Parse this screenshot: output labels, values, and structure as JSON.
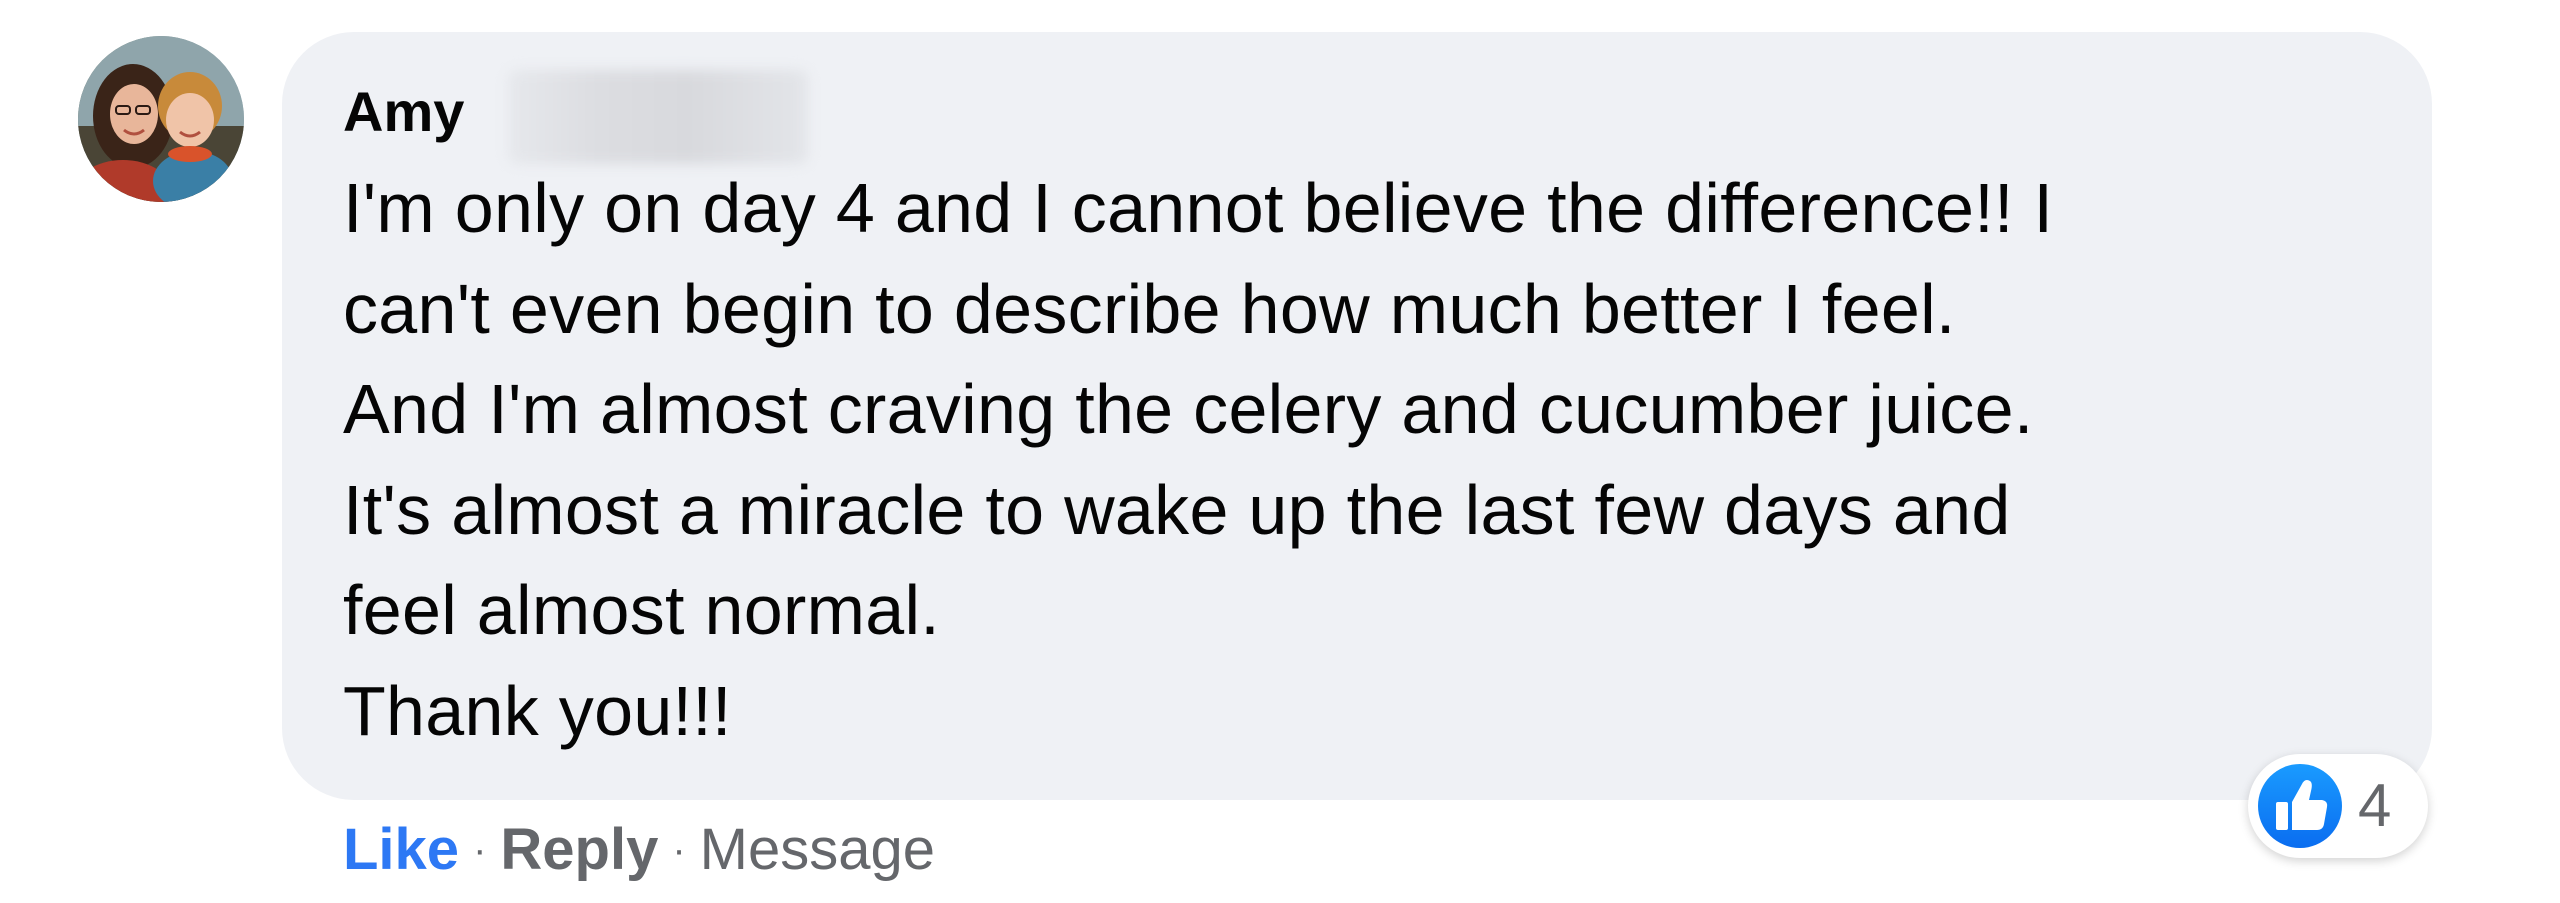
{
  "comment": {
    "author_first_name": "Amy",
    "lines": [
      "I'm only on day 4 and I cannot believe the difference!! I",
      "can't even begin to describe how much better I feel.",
      "And I'm almost craving the celery and cucumber juice.",
      "It's almost a miracle to wake up the last few days and",
      "feel almost normal.",
      "Thank you!!!"
    ]
  },
  "actions": {
    "like_label": "Like",
    "separator": "·",
    "reply_label": "Reply",
    "message_label": "Message"
  },
  "reactions": {
    "icon": "thumbs-up-icon",
    "count": "4",
    "color": "#1877f2"
  },
  "colors": {
    "bubble": "#eff1f5",
    "text": "#050505",
    "like_action": "#2d78f4",
    "secondary": "#65676b"
  }
}
